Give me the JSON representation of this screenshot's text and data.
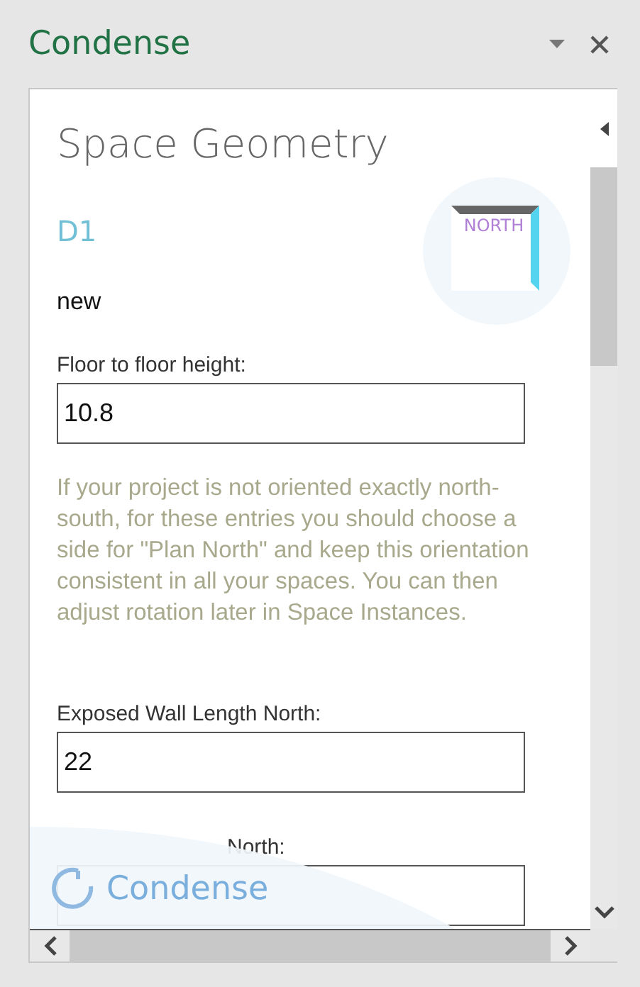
{
  "pane": {
    "title": "Condense"
  },
  "header": {
    "title": "Space Geometry",
    "space_name": "D1",
    "status": "new",
    "compass_label": "NORTH"
  },
  "fields": [
    {
      "label": "Floor to floor height:",
      "value": "10.8"
    }
  ],
  "note": "If your project is not oriented exactly north-south, for these entries you should choose a side for \"Plan North\" and keep this orientation consistent in all your spaces. You can then adjust rotation later in Space Instances.",
  "fields_north": [
    {
      "label": "Exposed Wall Length North:",
      "value": "22"
    },
    {
      "label": "North:"
    }
  ],
  "overlay": {
    "logo_text": "Condense"
  }
}
